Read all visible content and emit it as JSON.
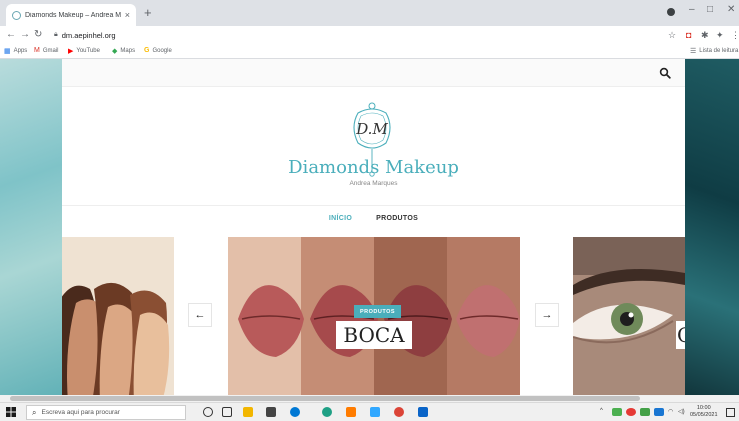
{
  "browser": {
    "tab_title": "Diamonds Makeup – Andrea Ma",
    "tab_close": "×",
    "new_tab": "+",
    "url": "dm.aepinhel.org",
    "bookmarks": [
      {
        "label": "Apps",
        "icon": "apps-grid-icon",
        "color": "#1a73e8"
      },
      {
        "label": "Gmail",
        "icon": "gmail-icon",
        "color": "#d93025"
      },
      {
        "label": "YouTube",
        "icon": "youtube-icon",
        "color": "#ff0000"
      },
      {
        "label": "Maps",
        "icon": "maps-icon",
        "color": "#34a853"
      },
      {
        "label": "Google",
        "icon": "google-icon",
        "color": "#fbbc04"
      }
    ],
    "reading_list": "Lista de leitura"
  },
  "site": {
    "accent_color": "#4aaebb",
    "logo_monogram": "D.M",
    "title": "Diamonds Makeup",
    "tagline": "Andrea Marques",
    "nav": [
      {
        "label": "INÍCIO",
        "active": true
      },
      {
        "label": "PRODUTOS",
        "active": false
      }
    ],
    "carousel": {
      "prev_arrow": "←",
      "next_arrow": "→",
      "category": "PRODUTOS",
      "slide_title": "BOCA",
      "next_slide_peek": "O"
    }
  },
  "taskbar": {
    "search_placeholder": "Escreva aqui para procurar",
    "clock_time": "10:00",
    "clock_date": "05/05/2021",
    "apps": [
      {
        "icon": "cortana-icon",
        "color": "#333333"
      },
      {
        "icon": "task-view-icon",
        "color": "#333333"
      },
      {
        "icon": "file-explorer-icon",
        "color": "#f2b600"
      },
      {
        "icon": "store-icon",
        "color": "#444444"
      },
      {
        "icon": "skype-icon",
        "color": "#0078d4"
      },
      {
        "icon": "edge-icon",
        "color": "#1fa085"
      },
      {
        "icon": "illustrator-icon",
        "color": "#ff7c00"
      },
      {
        "icon": "photoshop-icon",
        "color": "#31a8ff"
      },
      {
        "icon": "chrome-icon",
        "color": "#db4437"
      },
      {
        "icon": "outlook-icon",
        "color": "#0a64c8"
      }
    ]
  }
}
